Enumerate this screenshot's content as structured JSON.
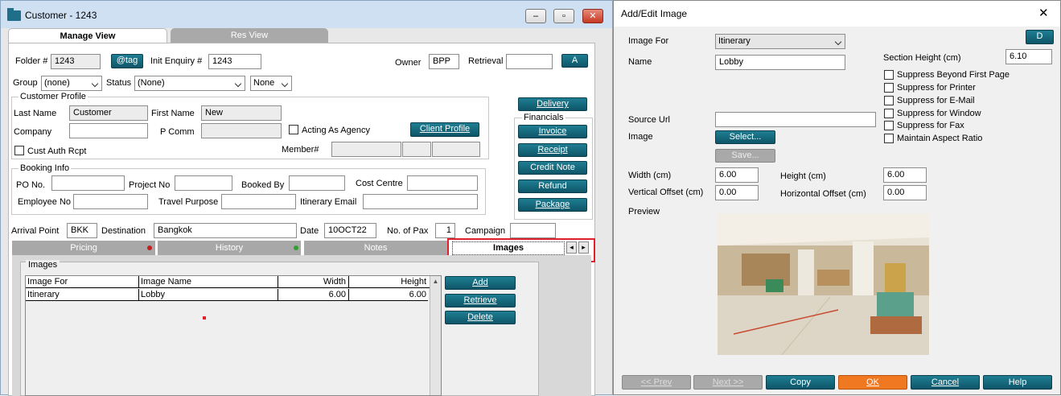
{
  "main_window": {
    "title": "Customer - 1243",
    "minimize_glyph": "–",
    "maximize_glyph": "▫",
    "close_glyph": "✕",
    "tabs": [
      "Manage View",
      "Res View"
    ],
    "header": {
      "folder_label": "Folder #",
      "folder_value": "1243",
      "tag_button": "@tag",
      "init_enquiry_label": "Init Enquiry #",
      "init_enquiry_value": "1243",
      "owner_label": "Owner",
      "owner_value": "BPP",
      "retrieval_label": "Retrieval",
      "retrieval_value": "",
      "a_button": "A",
      "group_label": "Group",
      "group_value": "(none)",
      "status_label": "Status",
      "status_value": "(None)",
      "none_value": "None"
    },
    "customer_profile": {
      "title": "Customer Profile",
      "last_name_label": "Last Name",
      "last_name_value": "Customer",
      "first_name_label": "First Name",
      "first_name_value": "New",
      "company_label": "Company",
      "company_value": "",
      "pcomm_label": "P Comm",
      "pcomm_value": "",
      "acting_as_agency_label": "Acting As Agency",
      "client_profile_button": "Client Profile",
      "cust_auth_label": "Cust Auth Rcpt",
      "member_label": "Member#"
    },
    "booking_info": {
      "title": "Booking Info",
      "po_label": "PO No.",
      "project_label": "Project No",
      "booked_by_label": "Booked By",
      "cost_centre_label": "Cost Centre",
      "employee_label": "Employee No",
      "travel_purpose_label": "Travel Purpose",
      "itinerary_email_label": "Itinerary Email"
    },
    "side_buttons": {
      "delivery": "Delivery",
      "financials_title": "Financials",
      "invoice": "Invoice",
      "receipt": "Receipt",
      "credit_note": "Credit Note",
      "refund": "Refund",
      "package": "Package"
    },
    "trip": {
      "arrival_label": "Arrival Point",
      "arrival_value": "BKK",
      "destination_label": "Destination",
      "destination_value": "Bangkok",
      "date_label": "Date",
      "date_value": "10OCT22",
      "pax_label": "No. of Pax",
      "pax_value": "1",
      "campaign_label": "Campaign",
      "campaign_value": ""
    },
    "section_tabs": [
      "Pricing",
      "History",
      "Notes",
      "Images"
    ],
    "tab_scroll_left": "◂",
    "tab_scroll_right": "▸",
    "images_group": {
      "title": "Images",
      "columns": [
        "Image For",
        "Image Name",
        "Width",
        "Height"
      ],
      "rows": [
        {
          "image_for": "Itinerary",
          "image_name": "Lobby",
          "width": "6.00",
          "height": "6.00"
        }
      ],
      "scroll_up_glyph": "▲",
      "add_button": "Add",
      "retrieve_button": "Retrieve",
      "delete_button": "Delete"
    },
    "colors": {
      "accent_button": "#136a7e",
      "highlight_box": "#e0202a",
      "pricing_dot": "#c02020",
      "history_dot": "#30a030"
    }
  },
  "dialog": {
    "title": "Add/Edit Image",
    "close_glyph": "✕",
    "image_for_label": "Image For",
    "image_for_value": "Itinerary",
    "d_button": "D",
    "name_label": "Name",
    "name_value": "Lobby",
    "section_height_label": "Section Height (cm)",
    "section_height_value": "6.10",
    "checkboxes": [
      "Suppress Beyond First Page",
      "Suppress for Printer",
      "Suppress for E-Mail",
      "Suppress for Window",
      "Suppress for Fax",
      "Maintain Aspect Ratio"
    ],
    "source_url_label": "Source Url",
    "source_url_value": "",
    "image_label": "Image",
    "select_button": "Select...",
    "save_button": "Save...",
    "width_label": "Width (cm)",
    "width_value": "6.00",
    "height_label": "Height (cm)",
    "height_value": "6.00",
    "voffset_label": "Vertical Offset (cm)",
    "voffset_value": "0.00",
    "hoffset_label": "Horizontal Offset (cm)",
    "hoffset_value": "0.00",
    "preview_label": "Preview",
    "footer": {
      "prev": "<< Prev",
      "next": "Next >>",
      "copy": "Copy",
      "ok": "OK",
      "cancel": "Cancel",
      "help": "Help"
    },
    "colors": {
      "ok_button": "#f07820"
    }
  }
}
